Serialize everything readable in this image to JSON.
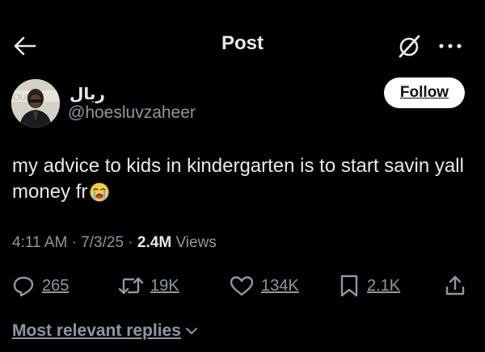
{
  "header": {
    "title": "Post",
    "back_icon": "arrow-left-icon",
    "grok_icon": "grok-slash-circle-icon",
    "more_icon": "more-dots-icon"
  },
  "author": {
    "display_name": "ربال",
    "handle": "@hoesluvzaheer",
    "follow_label": "Follow"
  },
  "tweet": {
    "text": "my advice to kids in kindergarten is to start savin yall money fr",
    "emoji": "loudly-crying-face-icon"
  },
  "meta": {
    "time": "4:11 AM",
    "sep1": " · ",
    "date": "7/3/25",
    "sep2": " · ",
    "views_count": "2.4M",
    "views_label": " Views"
  },
  "actions": {
    "replies": "265",
    "retweets": "19K",
    "likes": "134K",
    "bookmarks": "2.1K"
  },
  "replies_filter": {
    "label": "Most relevant replies"
  },
  "colors": {
    "background": "#000000",
    "text": "#e7e9ea",
    "secondary": "#8b98a5",
    "follow_bg": "#ffffff"
  }
}
